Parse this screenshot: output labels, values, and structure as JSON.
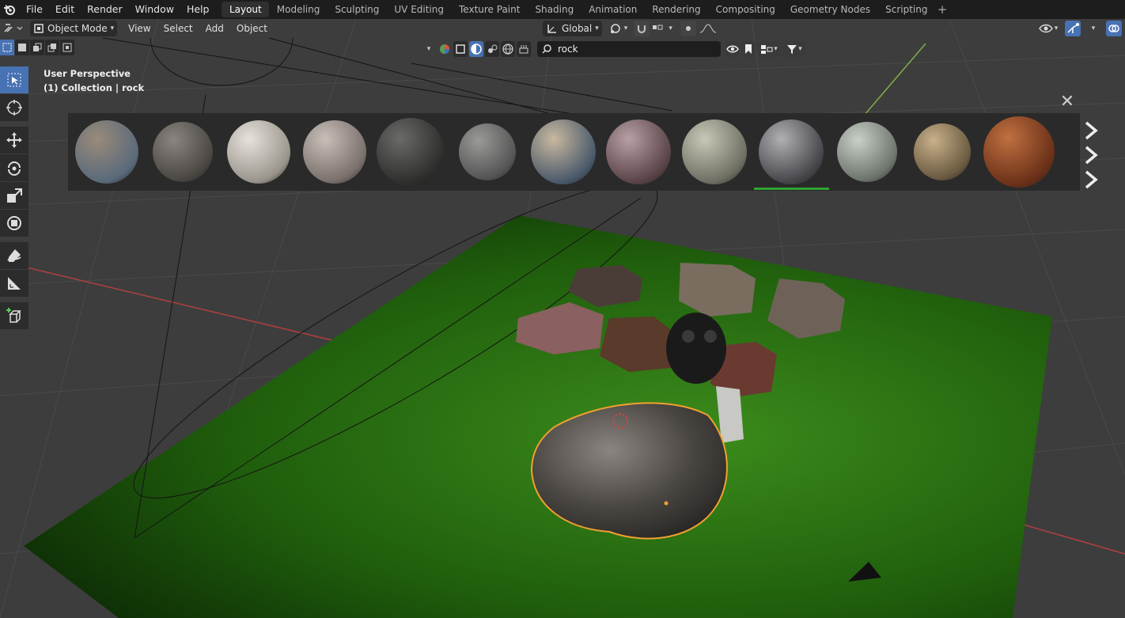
{
  "menu": {
    "file": "File",
    "edit": "Edit",
    "render": "Render",
    "window": "Window",
    "help": "Help"
  },
  "workspaces": [
    {
      "label": "Layout",
      "active": true
    },
    {
      "label": "Modeling",
      "active": false
    },
    {
      "label": "Sculpting",
      "active": false
    },
    {
      "label": "UV Editing",
      "active": false
    },
    {
      "label": "Texture Paint",
      "active": false
    },
    {
      "label": "Shading",
      "active": false
    },
    {
      "label": "Animation",
      "active": false
    },
    {
      "label": "Rendering",
      "active": false
    },
    {
      "label": "Compositing",
      "active": false
    },
    {
      "label": "Geometry Nodes",
      "active": false
    },
    {
      "label": "Scripting",
      "active": false
    }
  ],
  "header": {
    "mode": "Object Mode",
    "view": "View",
    "select": "Select",
    "add": "Add",
    "object": "Object",
    "orientation": "Global"
  },
  "asset_search": {
    "value": "rock",
    "placeholder": ""
  },
  "viewport_info": {
    "line1": "User Perspective",
    "line2": "(1) Collection | rock"
  },
  "materials": {
    "count": 13,
    "selected_index": 9,
    "colors": [
      [
        "#9a8a7a",
        "#5a6a7a"
      ],
      [
        "#8a8580",
        "#4a4642"
      ],
      [
        "#e6e2dc",
        "#9a958c"
      ],
      [
        "#c9bfb9",
        "#7a706b"
      ],
      [
        "#6a6a68",
        "#2d2d2c"
      ],
      [
        "#9a9a98",
        "#555"
      ],
      [
        "#c8b8a0",
        "#4a5a6a"
      ],
      [
        "#b8a0a4",
        "#5a4448"
      ],
      [
        "#c8c8b8",
        "#6e6e62"
      ],
      [
        "#b0b0b4",
        "#45454a"
      ],
      [
        "#c8d0c8",
        "#6c746c"
      ],
      [
        "#c8b08a",
        "#6a5a40"
      ],
      [
        "#c07040",
        "#6a3018"
      ]
    ]
  },
  "accent_color": "#4772b3",
  "selection_color": "#f0a030"
}
